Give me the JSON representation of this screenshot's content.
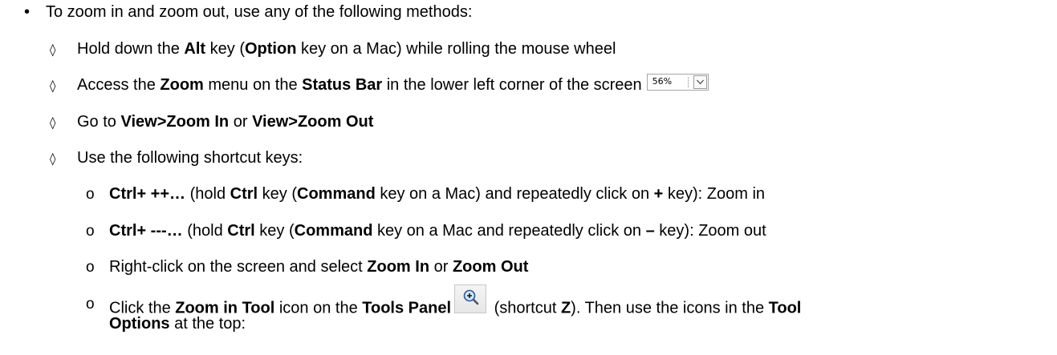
{
  "bullet_glyph": "•",
  "diamond_glyph": "◊",
  "circle_glyph": "o",
  "intro": "To zoom in and zoom out, use any of the following methods:",
  "method1": {
    "t1": "Hold down the ",
    "b1": "Alt",
    "t2": " key (",
    "b2": "Option",
    "t3": " key on a Mac) while rolling the mouse wheel"
  },
  "method2": {
    "t1": "Access the ",
    "b1": "Zoom",
    "t2": " menu on the ",
    "b2": "Status Bar",
    "t3": " in the lower left corner of the screen",
    "zoom_value": "56%"
  },
  "method3": {
    "t1": "Go to ",
    "b1": "View>Zoom In",
    "t2": " or ",
    "b2": "View>Zoom Out"
  },
  "method4": {
    "t1": "Use the following shortcut keys:"
  },
  "sub1": {
    "b1": "Ctrl+ ++…",
    "t1": " (hold ",
    "b2": "Ctrl",
    "t2": " key (",
    "b3": "Command",
    "t3": " key on a Mac) and repeatedly click on ",
    "b4": "+",
    "t4": " key):  Zoom in"
  },
  "sub2": {
    "b1": "Ctrl+ ---…",
    "t1": " (hold ",
    "b2": "Ctrl",
    "t2": " key (",
    "b3": "Command",
    "t3": " key on a Mac and repeatedly click on ",
    "b4": "–",
    "t4": " key):   Zoom out"
  },
  "sub3": {
    "t1": "Right-click on the screen and select ",
    "b1": "Zoom In",
    "t2": " or ",
    "b2": "Zoom Out"
  },
  "sub4": {
    "t1": "Click the ",
    "b1": "Zoom in Tool",
    "t2": " icon on the ",
    "b2": "Tools Panel",
    "t3": " (shortcut ",
    "b3": "Z",
    "t4": "). Then use the icons in the ",
    "b4": "Tool",
    "b5": "Options",
    "t5": " at the top:"
  },
  "icons": {
    "zoom_dropdown": "chevron-down-icon",
    "zoom_tool": "magnifier-plus-icon"
  }
}
